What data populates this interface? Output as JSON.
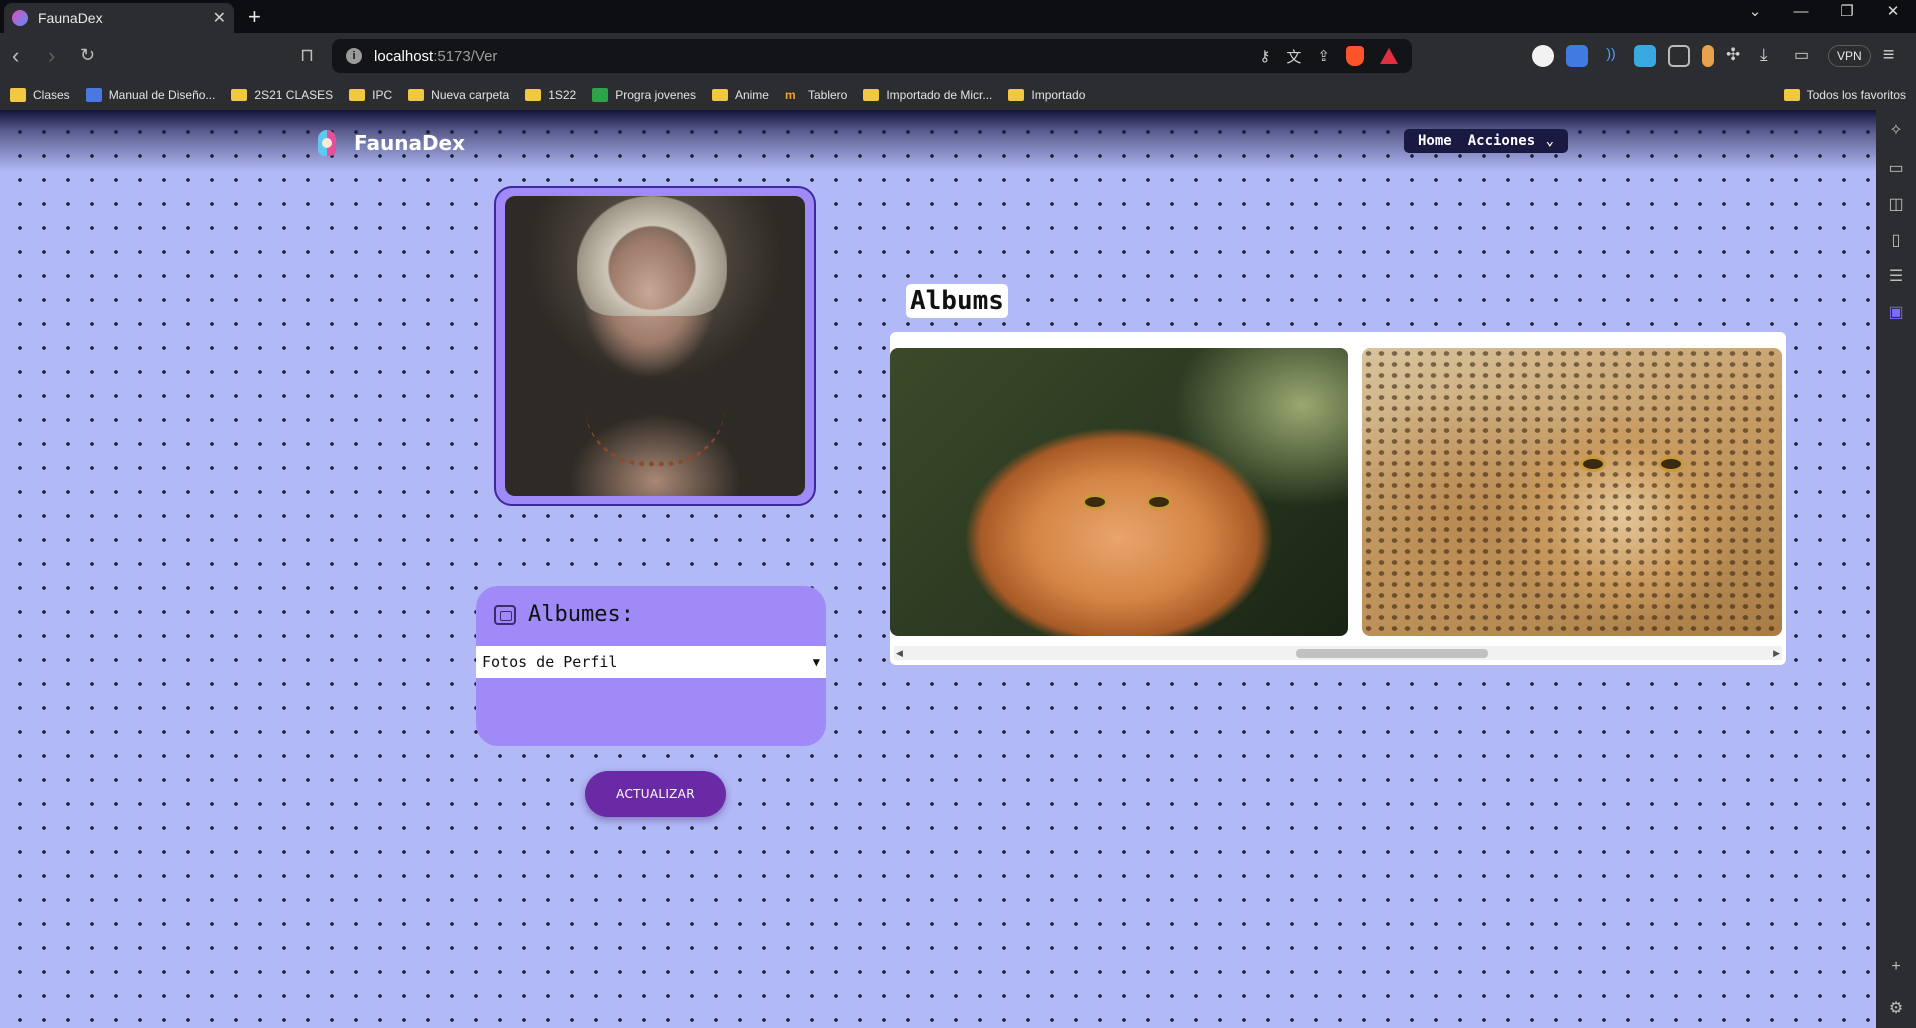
{
  "browser": {
    "tab_title": "FaunaDex",
    "url_host": "localhost",
    "url_path": ":5173/Ver",
    "vpn_label": "VPN",
    "bookmarks": [
      "Clases",
      "Manual de Diseño...",
      "2S21 CLASES",
      "IPC",
      "Nueva carpeta",
      "1S22",
      "Progra jovenes",
      "Anime",
      "Tablero",
      "Importado de Micr...",
      "Importado"
    ],
    "all_bookmarks_label": "Todos los favoritos"
  },
  "app": {
    "brand": "FaunaDex",
    "nav": {
      "home": "Home",
      "actions": "Acciones"
    }
  },
  "profile": {
    "photo_alt": "profile-photo"
  },
  "albums_section": {
    "title": "Albums",
    "cards": [
      "cat",
      "cheetah"
    ]
  },
  "albumes_box": {
    "title": "Albumes:",
    "selected": "Fotos de Perfil"
  },
  "actions": {
    "update_label": "ACTUALIZAR"
  },
  "colors": {
    "page_bg": "#b1b9f7",
    "panel_purple": "#a08af7",
    "button": "#6a2aa6",
    "nav_bg": "#191942"
  }
}
